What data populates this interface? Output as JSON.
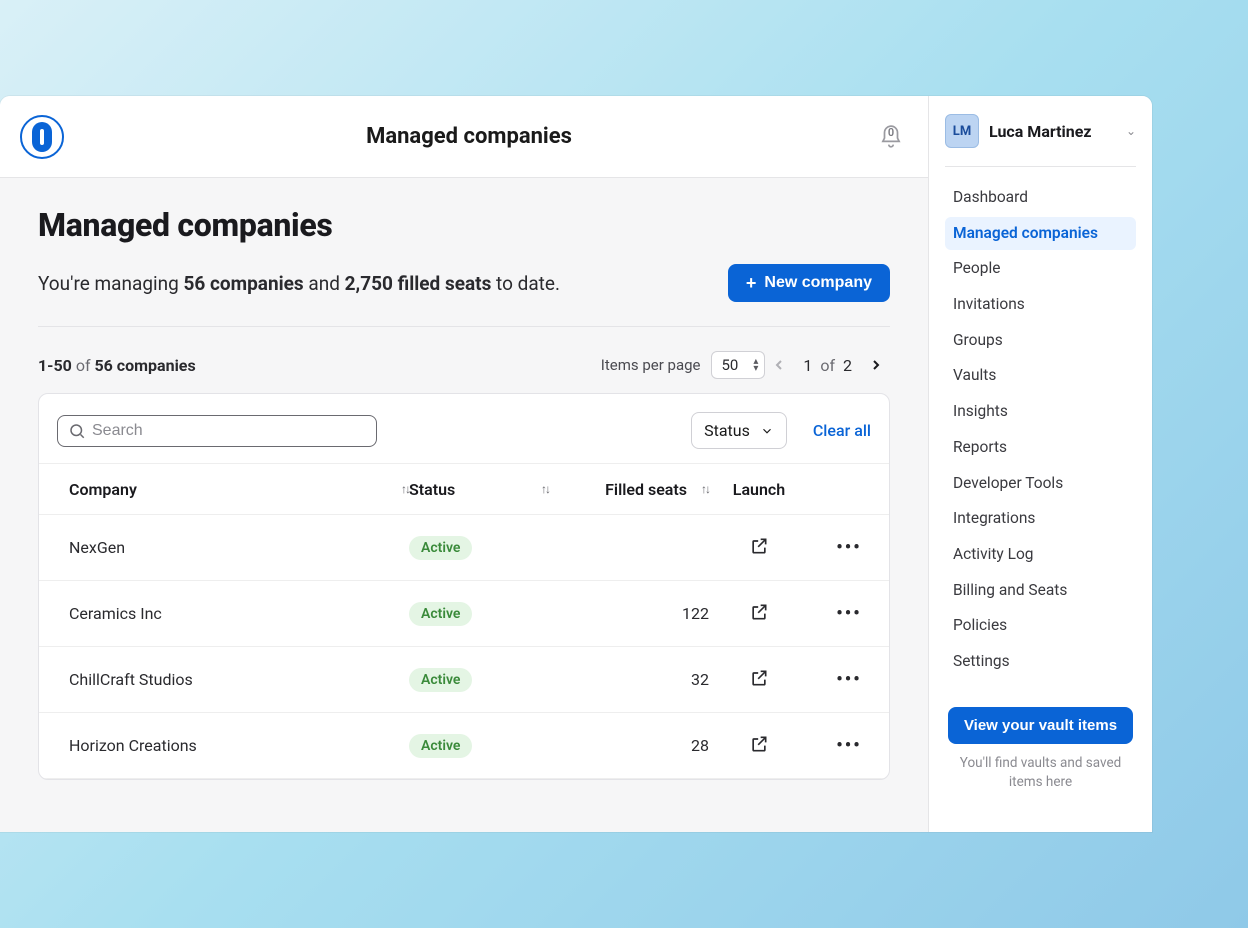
{
  "header": {
    "title": "Managed companies",
    "notification_count": "0"
  },
  "page": {
    "heading": "Managed companies",
    "summary_prefix": "You're managing ",
    "companies_count": "56 companies",
    "summary_mid": " and ",
    "filled_seats": "2,750 filled seats",
    "summary_suffix": " to date.",
    "new_company_label": "New company"
  },
  "pager": {
    "range": "1-50",
    "of_label": "of",
    "total": "56 companies",
    "items_per_page_label": "Items per page",
    "items_per_page_value": "50",
    "page_current": "1",
    "page_total": "2"
  },
  "filters": {
    "search_placeholder": "Search",
    "status_label": "Status",
    "clear_all_label": "Clear all"
  },
  "columns": {
    "company": "Company",
    "status": "Status",
    "filled": "Filled seats",
    "launch": "Launch"
  },
  "rows": [
    {
      "company": "NexGen",
      "status": "Active",
      "filled": ""
    },
    {
      "company": "Ceramics Inc",
      "status": "Active",
      "filled": "122"
    },
    {
      "company": "ChillCraft Studios",
      "status": "Active",
      "filled": "32"
    },
    {
      "company": "Horizon Creations",
      "status": "Active",
      "filled": "28"
    }
  ],
  "user": {
    "initials": "LM",
    "name": "Luca Martinez"
  },
  "nav": [
    {
      "label": "Dashboard",
      "active": false
    },
    {
      "label": "Managed companies",
      "active": true
    },
    {
      "label": "People",
      "active": false
    },
    {
      "label": "Invitations",
      "active": false
    },
    {
      "label": "Groups",
      "active": false
    },
    {
      "label": "Vaults",
      "active": false
    },
    {
      "label": "Insights",
      "active": false
    },
    {
      "label": "Reports",
      "active": false
    },
    {
      "label": "Developer Tools",
      "active": false
    },
    {
      "label": "Integrations",
      "active": false
    },
    {
      "label": "Activity Log",
      "active": false
    },
    {
      "label": "Billing and Seats",
      "active": false
    },
    {
      "label": "Policies",
      "active": false
    },
    {
      "label": "Settings",
      "active": false
    }
  ],
  "vault": {
    "button": "View your vault items",
    "note": "You'll find vaults and saved items here"
  }
}
